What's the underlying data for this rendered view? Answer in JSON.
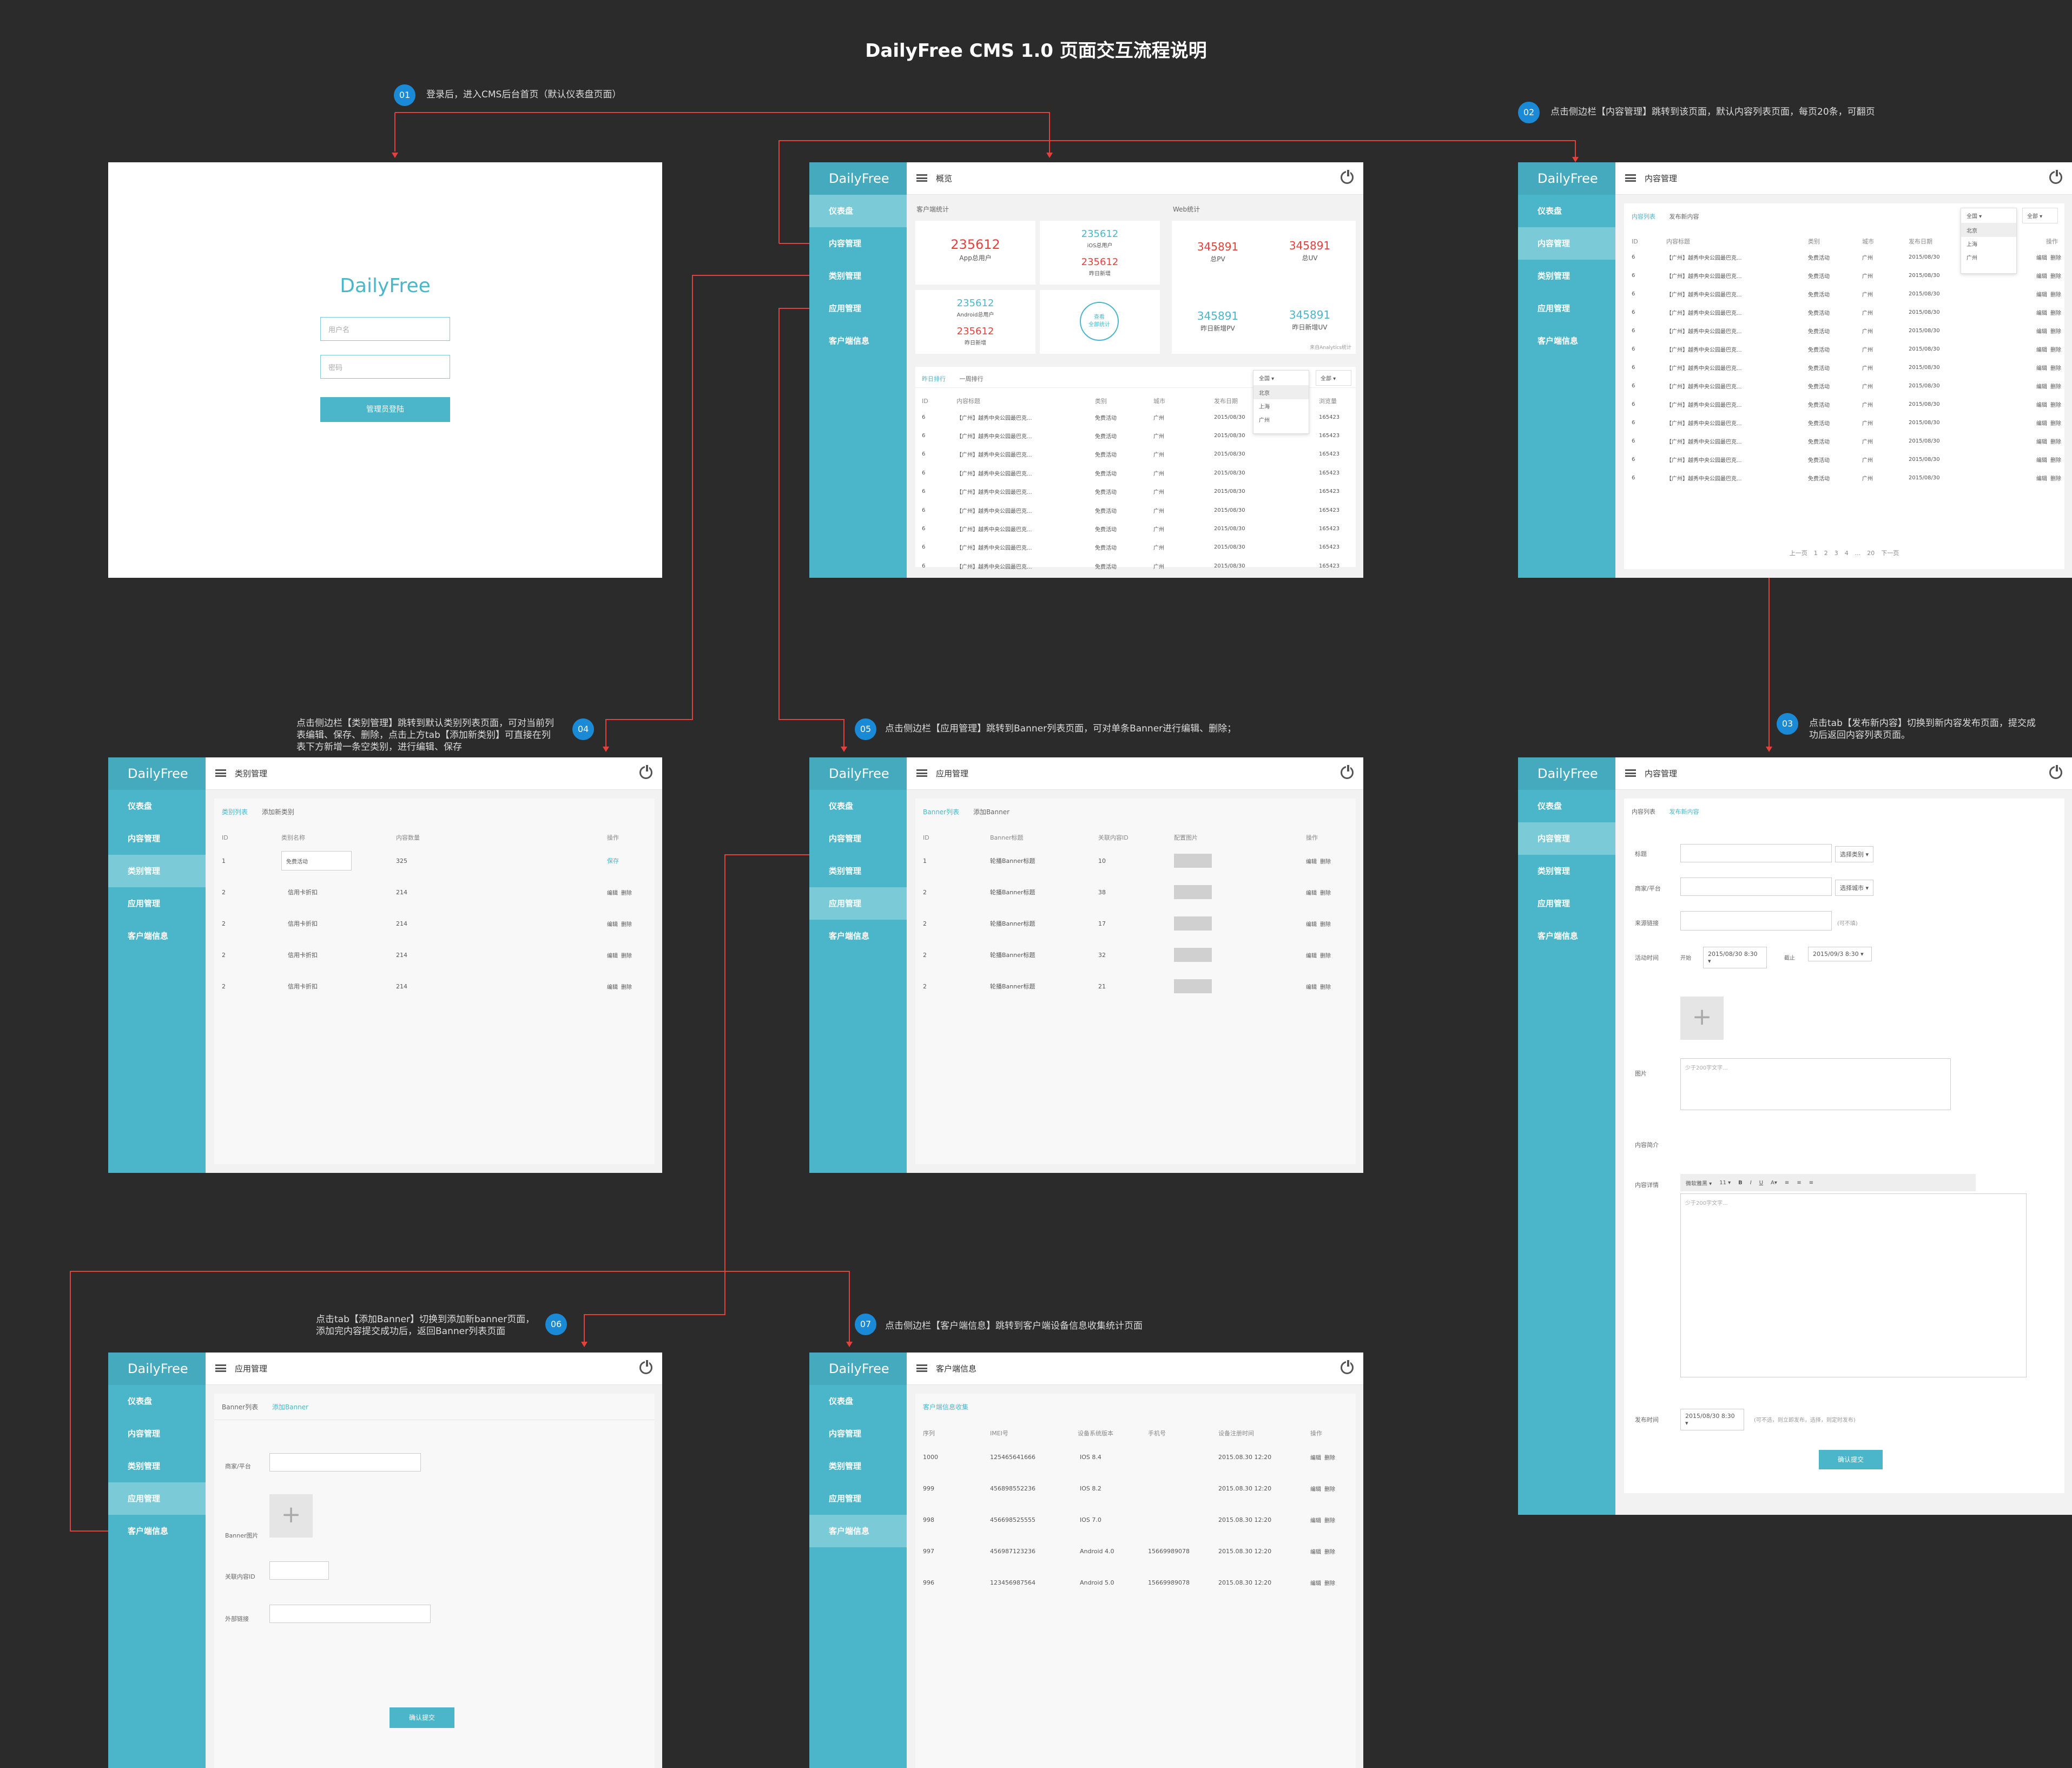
{
  "title": "DailyFree CMS 1.0 页面交互流程说明",
  "steps": [
    {
      "num": "01",
      "text": "登录后，进入CMS后台首页（默认仪表盘页面）"
    },
    {
      "num": "02",
      "text": "点击侧边栏【内容管理】跳转到该页面，默认内容列表页面，每页20条，可翻页"
    },
    {
      "num": "03",
      "text": "点击tab【发布新内容】切换到新内容发布页面，提交成功后返回内容列表页面。"
    },
    {
      "num": "04",
      "text": "点击侧边栏【类别管理】跳转到默认类别列表页面，可对当前列表编辑、保存、删除，点击上方tab【添加新类别】可直接在列表下方新增一条空类别，进行编辑、保存"
    },
    {
      "num": "05",
      "text": "点击侧边栏【应用管理】跳转到Banner列表页面，可对单条Banner进行编辑、删除；"
    },
    {
      "num": "06",
      "text": "点击tab【添加Banner】切换到添加新banner页面，添加完内容提交成功后，返回Banner列表页面"
    },
    {
      "num": "07",
      "text": "点击侧边栏【客户端信息】跳转到客户端设备信息收集统计页面"
    }
  ],
  "app": {
    "logo": "DailyFree",
    "menu": [
      "仪表盘",
      "内容管理",
      "类别管理",
      "应用管理",
      "客户端信息"
    ],
    "edit": "编辑",
    "del": "删除"
  },
  "login": {
    "username_placeholder": "用户名",
    "password_placeholder": "密码",
    "button": "管理员登陆"
  },
  "dashboard": {
    "top_title": "概览",
    "client_stats_label": "客户端统计",
    "web_stats_label": "Web统计",
    "app_users": {
      "value": "235612",
      "label": "App总用户"
    },
    "ios_users": {
      "value": "235612",
      "label": "iOS总用户"
    },
    "ios_new": {
      "value": "235612",
      "label": "昨日新增"
    },
    "android_users": {
      "value": "235612",
      "label": "Android总用户"
    },
    "android_new": {
      "value": "235612",
      "label": "昨日新增"
    },
    "more": "查看\n全部统计",
    "total_pv": {
      "value": "345891",
      "label": "总PV"
    },
    "total_uv": {
      "value": "345891",
      "label": "总UV"
    },
    "new_pv": {
      "value": "345891",
      "label": "昨日新增PV"
    },
    "new_uv": {
      "value": "345891",
      "label": "昨日新增UV"
    },
    "source": "来自Analytics统计",
    "rank_tabs": [
      "昨日排行",
      "一周排行"
    ],
    "filter_city": "全国",
    "filter_type": "全部",
    "city_options": [
      "北京",
      "上海",
      "广州"
    ],
    "headers": [
      "ID",
      "内容标题",
      "类别",
      "城市",
      "发布日期",
      "浏览量"
    ],
    "row": {
      "id": "6",
      "title": "【广州】越秀中央公园最巴克...",
      "type": "免费活动",
      "city": "广州",
      "date": "2015/08/30",
      "views": "165423"
    }
  },
  "content_list": {
    "top_title": "内容管理",
    "tabs": [
      "内容列表",
      "发布新内容"
    ],
    "filter_city": "全国",
    "filter_type": "全部",
    "city_options": [
      "北京",
      "上海",
      "广州"
    ],
    "headers": [
      "ID",
      "内容标题",
      "类别",
      "城市",
      "发布日期",
      "操作"
    ],
    "row": {
      "id": "6",
      "title": "【广州】越秀中央公园最巴克...",
      "type": "免费活动",
      "city": "广州",
      "date": "2015/08/30"
    },
    "pager": [
      "上一页",
      "1",
      "2",
      "3",
      "4",
      "...",
      "20",
      "下一页"
    ]
  },
  "category": {
    "top_title": "类别管理",
    "tabs": [
      "类别列表",
      "添加新类别"
    ],
    "headers": [
      "ID",
      "类别名称",
      "内容数量",
      "操作"
    ],
    "first": {
      "id": "1",
      "name": "免费活动",
      "count": "325",
      "action": "保存"
    },
    "rows": [
      {
        "id": "2",
        "name": "信用卡折扣",
        "count": "214"
      },
      {
        "id": "2",
        "name": "信用卡折扣",
        "count": "214"
      },
      {
        "id": "2",
        "name": "信用卡折扣",
        "count": "214"
      },
      {
        "id": "2",
        "name": "信用卡折扣",
        "count": "214"
      }
    ]
  },
  "banner_list": {
    "top_title": "应用管理",
    "tabs": [
      "Banner列表",
      "添加Banner"
    ],
    "headers": [
      "ID",
      "Banner标题",
      "关联内容ID",
      "配置图片",
      "操作"
    ],
    "rows": [
      {
        "id": "1",
        "title": "轮播Banner标题",
        "rel": "10"
      },
      {
        "id": "2",
        "title": "轮播Banner标题",
        "rel": "38"
      },
      {
        "id": "2",
        "title": "轮播Banner标题",
        "rel": "17"
      },
      {
        "id": "2",
        "title": "轮播Banner标题",
        "rel": "32"
      },
      {
        "id": "2",
        "title": "轮播Banner标题",
        "rel": "21"
      }
    ]
  },
  "publish": {
    "top_title": "内容管理",
    "tabs": [
      "内容列表",
      "发布新内容"
    ],
    "f_title": "标题",
    "choose_type": "选择类别",
    "f_merchant": "商家/平台",
    "choose_city": "选择城市",
    "f_link": "来源链接",
    "optional": "(可不填)",
    "f_time": "活动时间",
    "start": "开始",
    "start_value": "2015/08/30 8:30",
    "end": "截止",
    "end_value": "2015/09/3 8:30",
    "f_image": "图片",
    "f_intro": "内容简介",
    "intro_placeholder": "少于200字文字...",
    "f_detail": "内容详情",
    "toolbar_style": "微软雅黑",
    "toolbar_size": "11",
    "detail_placeholder": "少于200字文字...",
    "f_pubtime": "发布时间",
    "pub_value": "2015/08/30 8:30",
    "pub_hint": "(可不选，则立即发布，选择，则定时发布)",
    "submit": "确认提交"
  },
  "banner_add": {
    "top_title": "应用管理",
    "tabs": [
      "Banner列表",
      "添加Banner"
    ],
    "f_merchant": "商家/平台",
    "f_image": "Banner图片",
    "f_rel": "关联内容ID",
    "f_link": "外部链接",
    "submit": "确认提交"
  },
  "client_info": {
    "top_title": "客户端信息",
    "tab": "客户端信息收集",
    "headers": [
      "序列",
      "IMEI号",
      "设备系统版本",
      "手机号",
      "设备注册时间",
      "操作"
    ],
    "rows": [
      {
        "seq": "1000",
        "imei": "125465641666",
        "os": "IOS 8.4",
        "phone": "",
        "time": "2015.08.30  12:20"
      },
      {
        "seq": "999",
        "imei": "456898552236",
        "os": "IOS 8.2",
        "phone": "",
        "time": "2015.08.30  12:20"
      },
      {
        "seq": "998",
        "imei": "456698525555",
        "os": "IOS 7.0",
        "phone": "",
        "time": "2015.08.30  12:20"
      },
      {
        "seq": "997",
        "imei": "456987123236",
        "os": "Android 4.0",
        "phone": "15669989078",
        "time": "2015.08.30  12:20"
      },
      {
        "seq": "996",
        "imei": "123456987564",
        "os": "Android 5.0",
        "phone": "15669989078",
        "time": "2015.08.30  12:20"
      }
    ]
  },
  "colors": {
    "accent": "#4bb6ca",
    "sidebar": "#4bb6ca",
    "badge": "#1a8ad6",
    "arrow": "#e2423b",
    "background": "#2b2b2b"
  }
}
